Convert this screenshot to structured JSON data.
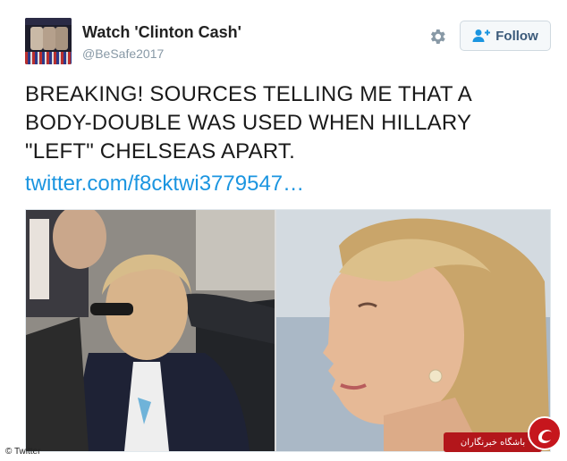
{
  "tweet": {
    "display_name": "Watch 'Clinton Cash'",
    "handle": "@BeSafe2017",
    "follow_label": "Follow",
    "text_lines": [
      "BREAKING! SOURCES TELLING ME THAT A",
      "BODY-DOUBLE WAS USED WHEN HILLARY",
      "\"LEFT\" CHELSEAS APART."
    ],
    "link_text": "twitter.com/f8cktwi3779547…"
  },
  "icons": {
    "settings": "gear-icon",
    "follow": "add-user-icon"
  },
  "media": {
    "credit": "© Twitter",
    "watermark_text": "باشگاه خبرنگاران"
  },
  "colors": {
    "link": "#1b95e0",
    "handle": "#8899a6",
    "watermark": "#c6161d"
  }
}
